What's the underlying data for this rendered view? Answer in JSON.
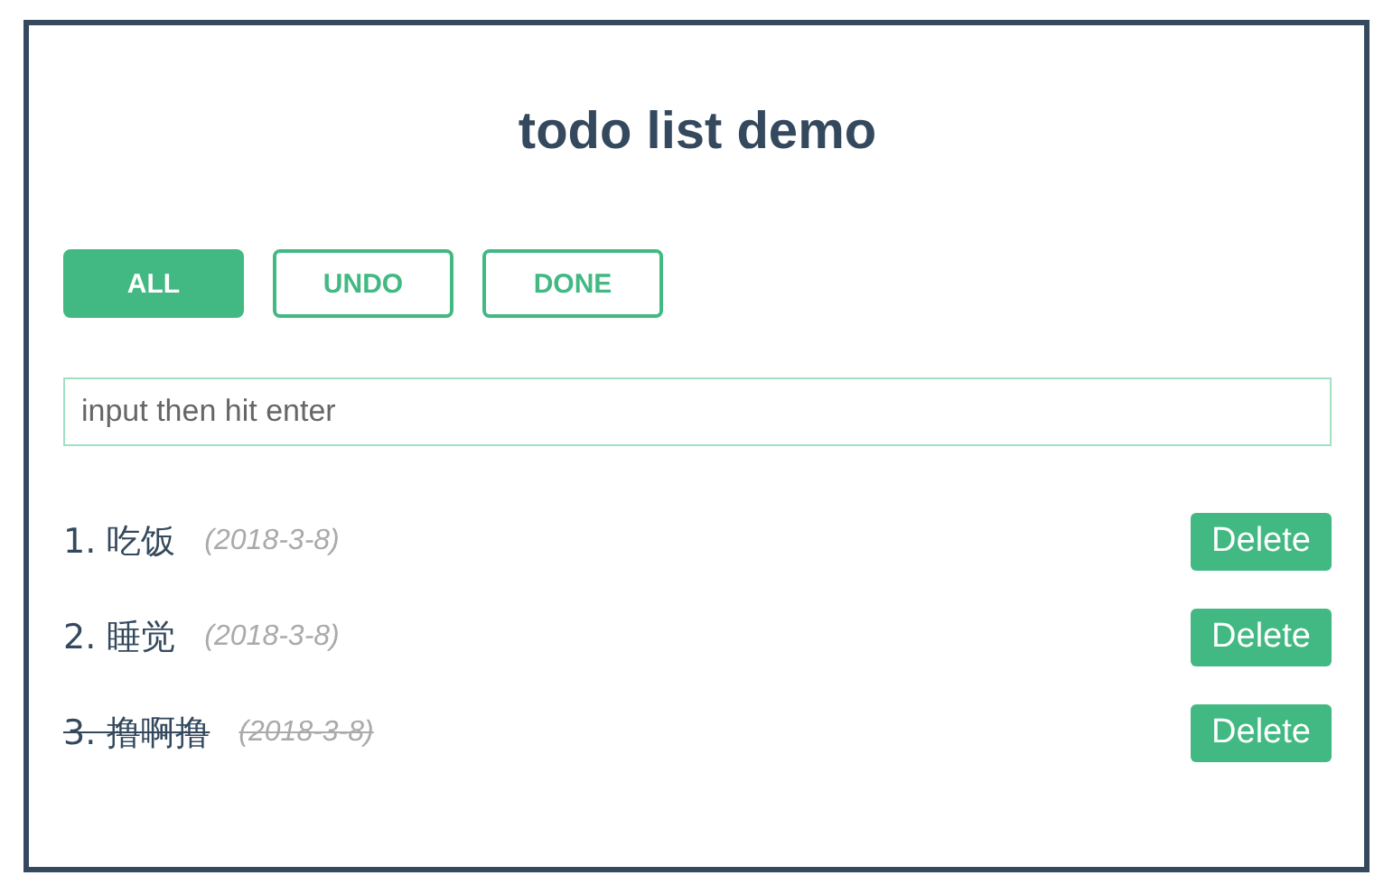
{
  "title": "todo list demo",
  "filters": [
    {
      "label": "ALL",
      "selected": true
    },
    {
      "label": "UNDO",
      "selected": false
    },
    {
      "label": "DONE",
      "selected": false
    }
  ],
  "input": {
    "placeholder": "input then hit enter"
  },
  "todos": [
    {
      "label": "1. 吃饭",
      "date": "(2018-3-8)",
      "done": false,
      "action": "Delete"
    },
    {
      "label": "2. 睡觉",
      "date": "(2018-3-8)",
      "done": false,
      "action": "Delete"
    },
    {
      "label": "3. 撸啊撸",
      "date": "(2018-3-8)",
      "done": true,
      "action": "Delete"
    }
  ]
}
